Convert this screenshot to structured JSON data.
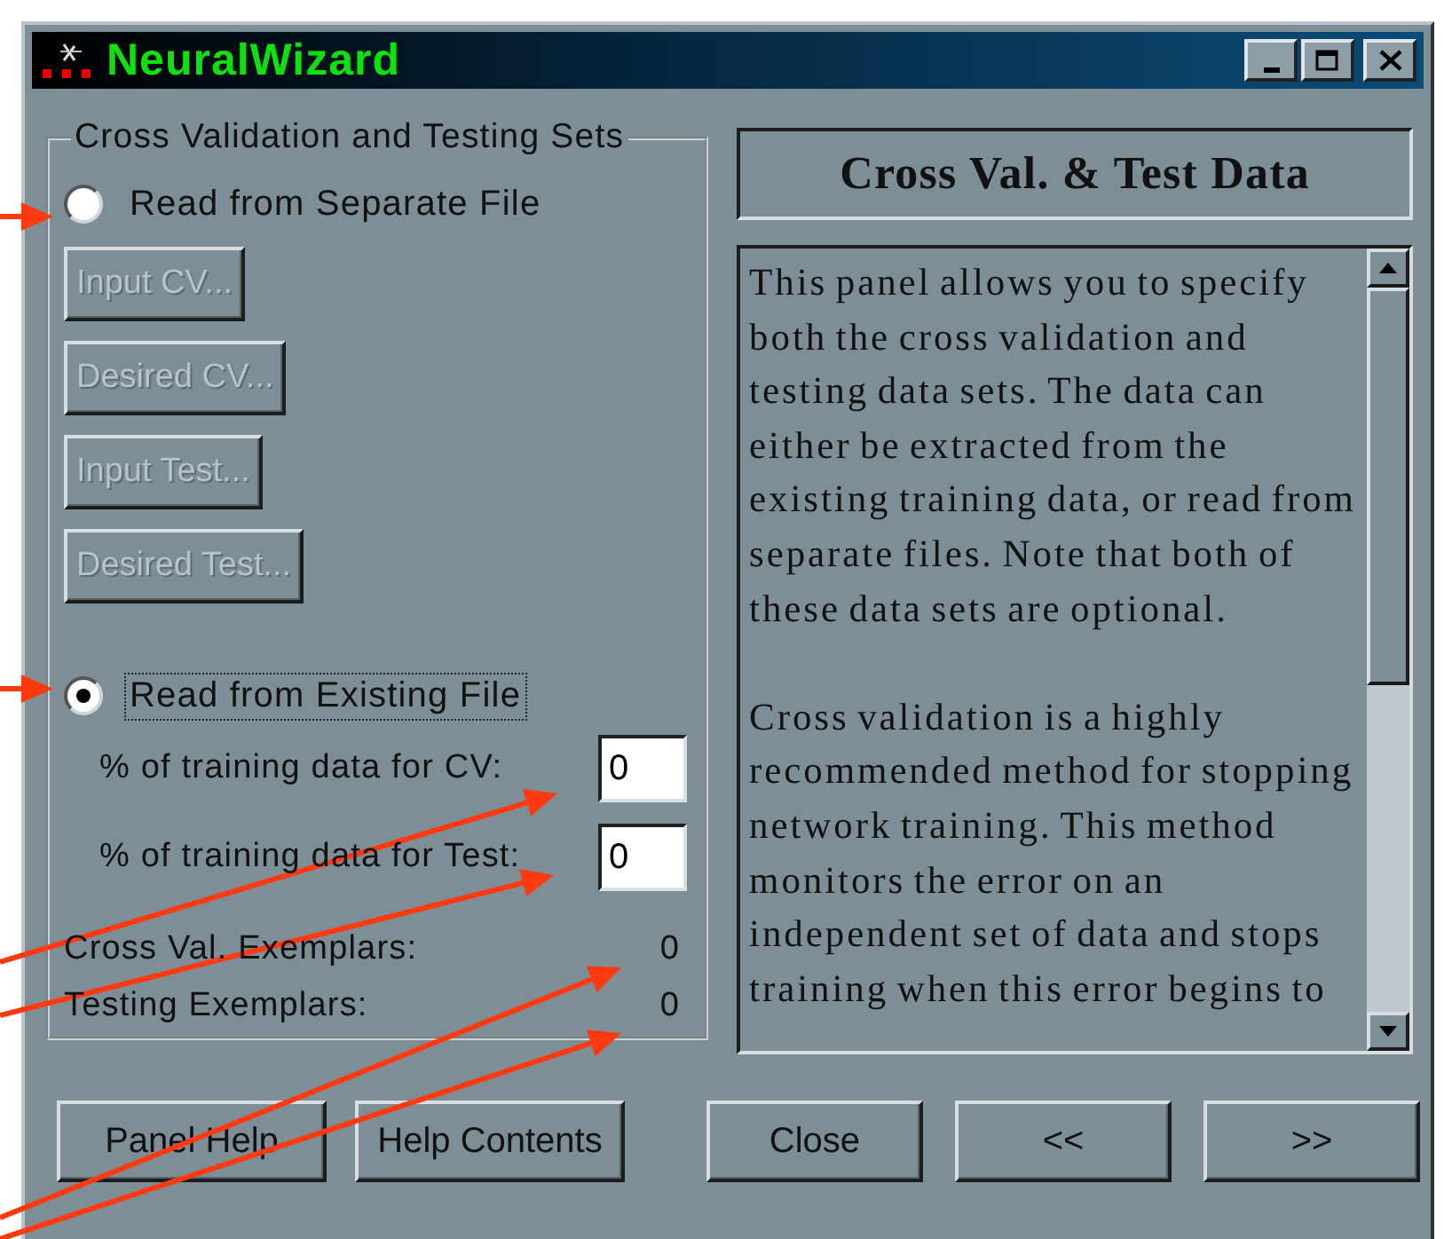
{
  "window": {
    "title": "NeuralWizard"
  },
  "group": {
    "title": "Cross Validation and Testing Sets",
    "options": [
      {
        "label": "Read from Separate File",
        "selected": false,
        "buttons": [
          {
            "label": "Input CV...",
            "disabled": true
          },
          {
            "label": "Desired CV...",
            "disabled": true
          },
          {
            "label": "Input Test...",
            "disabled": true
          },
          {
            "label": "Desired Test...",
            "disabled": true
          }
        ]
      },
      {
        "label": "Read from Existing File",
        "selected": true,
        "fields": [
          {
            "label": "% of training data for CV:",
            "value": "0"
          },
          {
            "label": "% of training data for Test:",
            "value": "0"
          }
        ]
      }
    ],
    "counts": [
      {
        "label": "Cross Val. Exemplars:",
        "value": "0"
      },
      {
        "label": "Testing Exemplars:",
        "value": "0"
      }
    ]
  },
  "panel": {
    "heading": "Cross Val. & Test Data",
    "paragraphs": [
      "This panel allows you to specify both the cross validation and testing data sets. The data can either be extracted from the existing training data, or read from separate files. Note that both of these data sets are optional.",
      "Cross validation is a highly recommended method for stopping network training. This method monitors the error on an independent set of data and stops training when this error begins to"
    ]
  },
  "buttons": [
    {
      "label": "Panel Help",
      "disabled": false
    },
    {
      "label": "Help Contents",
      "disabled": false
    },
    {
      "label": "Close",
      "disabled": false
    },
    {
      "label": "<<",
      "disabled": false
    },
    {
      "label": ">>",
      "disabled": false
    }
  ]
}
